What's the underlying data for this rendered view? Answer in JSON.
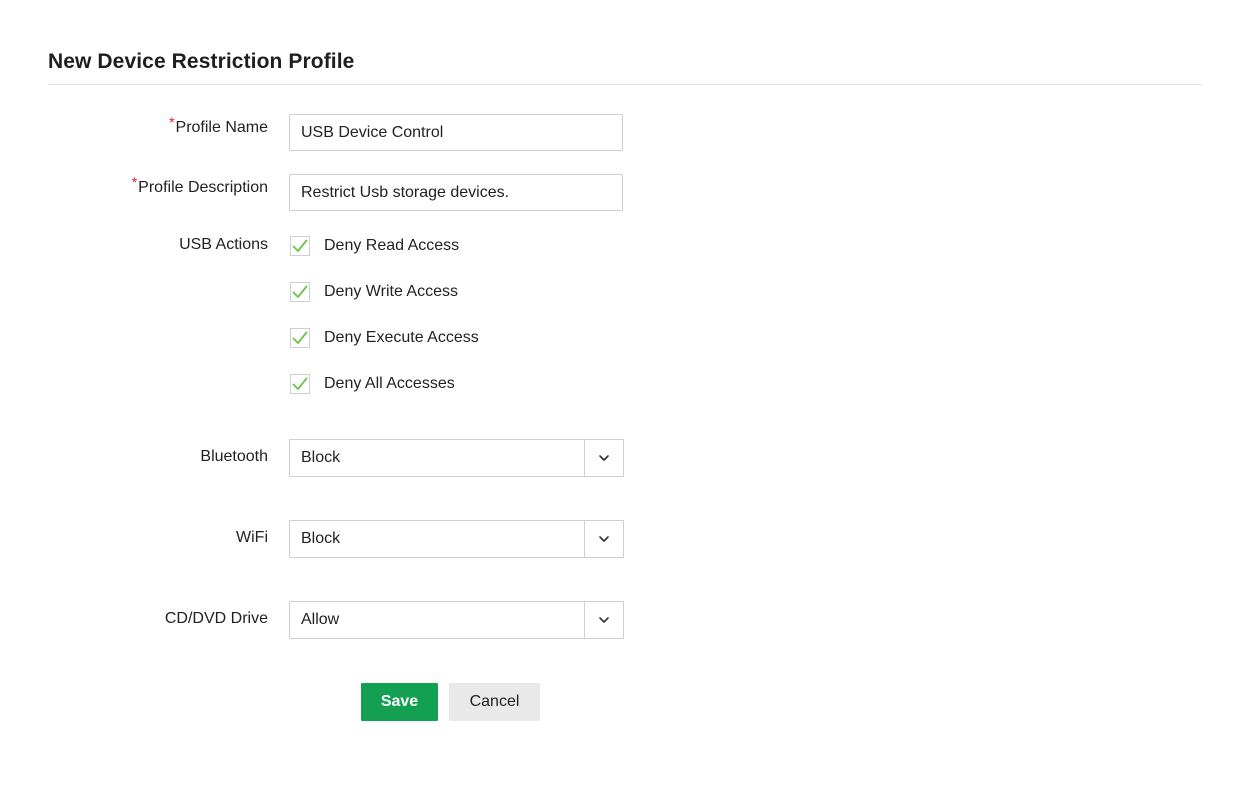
{
  "page": {
    "title": "New Device Restriction Profile"
  },
  "form": {
    "required_marker": "*",
    "profile_name": {
      "label": "Profile Name",
      "value": "USB Device Control",
      "required": true
    },
    "profile_description": {
      "label": "Profile Description",
      "value": "Restrict Usb storage devices.",
      "required": true
    },
    "usb_actions": {
      "label": "USB Actions",
      "options": [
        {
          "label": "Deny Read Access",
          "checked": true
        },
        {
          "label": "Deny Write Access",
          "checked": true
        },
        {
          "label": "Deny Execute Access",
          "checked": true
        },
        {
          "label": "Deny All Accesses",
          "checked": true
        }
      ]
    },
    "bluetooth": {
      "label": "Bluetooth",
      "selected": "Block"
    },
    "wifi": {
      "label": "WiFi",
      "selected": "Block"
    },
    "cd_dvd_drive": {
      "label": "CD/DVD Drive",
      "selected": "Allow"
    }
  },
  "actions": {
    "save_label": "Save",
    "cancel_label": "Cancel"
  },
  "icons": {
    "checkmark": "check-icon",
    "dropdown": "chevron-down-icon"
  },
  "colors": {
    "accent_green": "#13a053",
    "checkmark_green": "#6cc24a",
    "required_red": "#e02020",
    "cancel_bg": "#e9e9e9"
  }
}
